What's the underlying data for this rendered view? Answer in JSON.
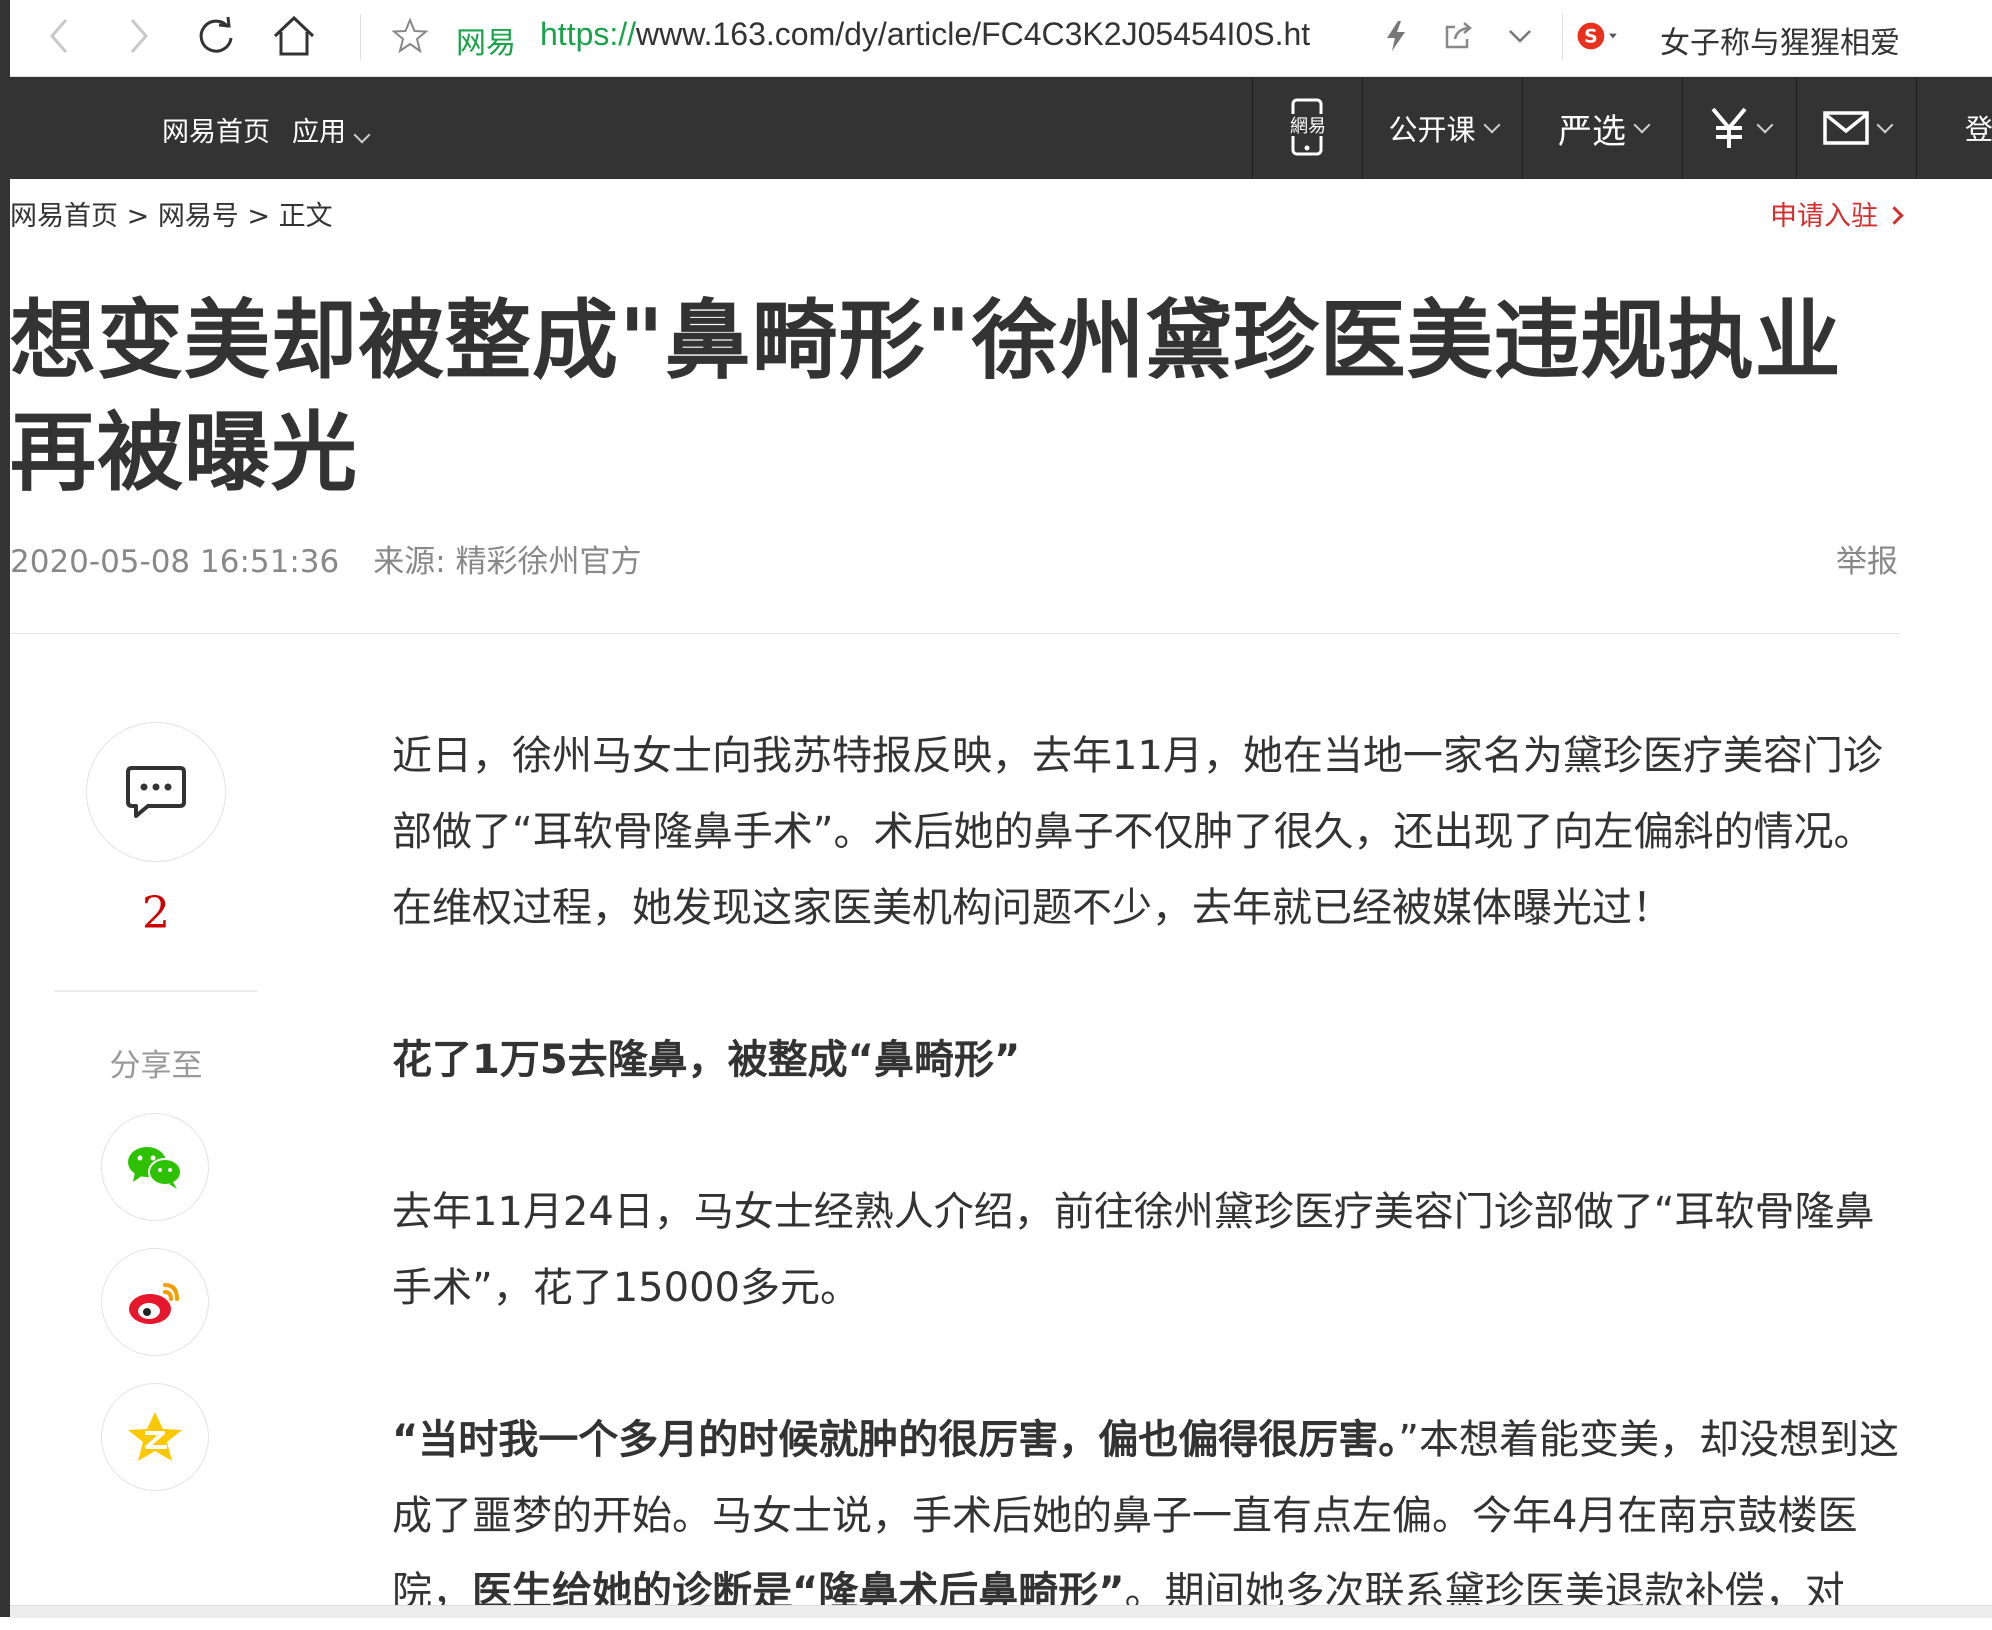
{
  "browser": {
    "site_name": "网易",
    "url_scheme": "https://",
    "url_rest": "www.163.com/dy/article/FC4C3K2J05454I0S.ht",
    "search_text": "女子称与猩猩相爱"
  },
  "site_header": {
    "home": "网易首页",
    "apps": "应用",
    "items": [
      "公开课",
      "严选"
    ]
  },
  "breadcrumb": {
    "home": "网易首页",
    "sep": ">",
    "section": "网易号",
    "current": "正文",
    "apply": "申请入驻"
  },
  "article": {
    "title": "想变美却被整成\"鼻畸形\"徐州黛珍医美违规执业再被曝光",
    "date": "2020-05-08 16:51:36",
    "source": "来源: 精彩徐州官方",
    "report": "举报",
    "p1": "近日，徐州马女士向我苏特报反映，去年11月，她在当地一家名为黛珍医疗美容门诊部做了“耳软骨隆鼻手术”。术后她的鼻子不仅肿了很久，还出现了向左偏斜的情况。在维权过程，她发现这家医美机构问题不少，去年就已经被媒体曝光过！",
    "subhead": "花了1万5去隆鼻，被整成“鼻畸形”",
    "p2": "去年11月24日，马女士经熟人介绍，前往徐州黛珍医疗美容门诊部做了“耳软骨隆鼻手术”，花了15000多元。",
    "p3_bold": "“当时我一个多月的时候就肿的很厉害，偏也偏得很厉害。",
    "p3_a": "”本想着能变美，却没想到这成了噩梦的开始。马女士说，手术后她的鼻子一直有点左偏。今年4月在南京鼓楼医院，",
    "p3_bold2": "医生给她的诊断是“隆鼻术后鼻畸形”",
    "p3_b": "。期间她多次联系黛珍医美退款补偿，对"
  },
  "share": {
    "comment_count": "2",
    "label": "分享至"
  },
  "colors": {
    "header_bg": "#333333",
    "accent_red": "#d32f2f",
    "url_green": "#1aa34a"
  }
}
